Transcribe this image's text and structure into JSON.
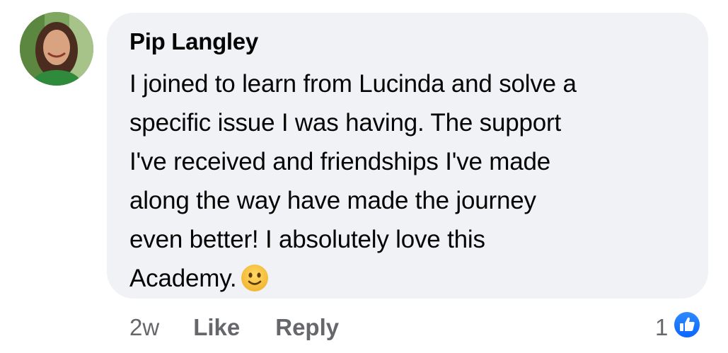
{
  "comment": {
    "author": "Pip Langley",
    "lines": [
      "I joined to learn from Lucinda and solve a",
      "specific issue I was having. The support",
      "I've received and friendships I've made",
      "along the way have made the journey",
      "even better! I absolutely love this",
      "Academy."
    ],
    "emoji": "slightly-smiling-face-icon",
    "timestamp": "2w",
    "like_label": "Like",
    "reply_label": "Reply",
    "reaction_count": "1",
    "reaction_icon": "like-thumbs-up-icon"
  },
  "colors": {
    "bubble": "#f0f2f5",
    "text": "#050505",
    "meta": "#65676b",
    "like_blue": "#1b74e4",
    "emoji_yellow": "#f7c740"
  }
}
